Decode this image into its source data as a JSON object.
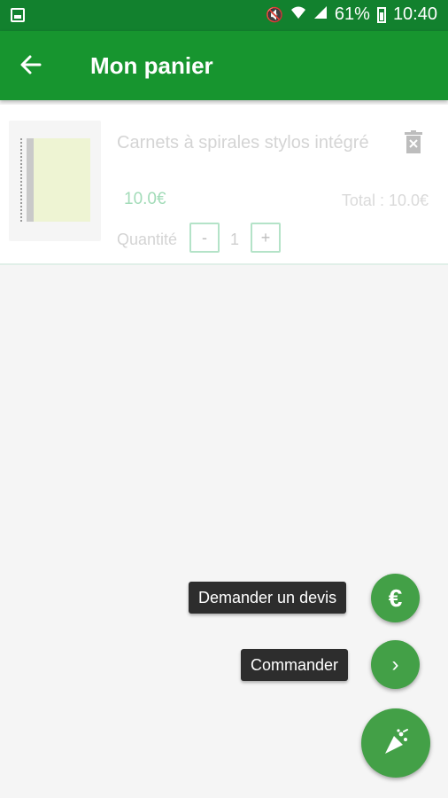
{
  "status_bar": {
    "battery_percent": "61%",
    "time": "10:40",
    "icons": [
      "gallery-icon",
      "mute-icon",
      "wifi-icon",
      "signal-icon",
      "battery-icon"
    ]
  },
  "app_bar": {
    "title": "Mon panier",
    "back_icon": "arrow-left-icon"
  },
  "cart": {
    "items": [
      {
        "name": "Carnets à spirales stylos intégré",
        "unit_price": "10.0€",
        "total": "Total : 10.0€",
        "quantity_label": "Quantité",
        "quantity": "1",
        "minus_label": "-",
        "plus_label": "+"
      }
    ]
  },
  "actions": {
    "quote_label": "Demander un devis",
    "quote_icon": "€",
    "order_label": "Commander",
    "order_icon": "›",
    "main_icon": "party-popper-icon"
  },
  "colors": {
    "status_bar": "#12812e",
    "app_bar": "#17952f",
    "fab": "#43a047",
    "price": "#a3dcb9"
  }
}
